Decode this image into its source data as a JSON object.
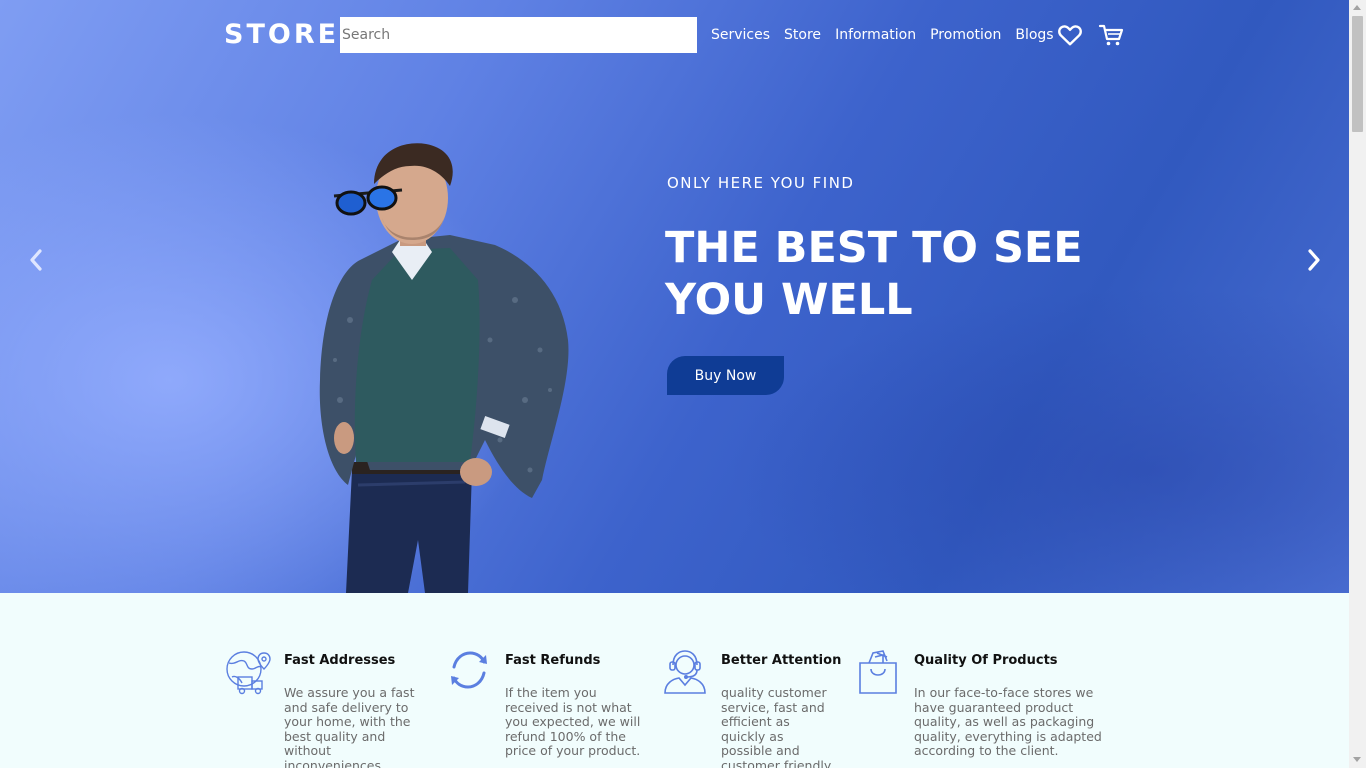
{
  "header": {
    "brand": "STORE",
    "search_placeholder": "Search",
    "nav": [
      "Services",
      "Store",
      "Information",
      "Promotion",
      "Blogs"
    ],
    "icons": [
      "heart-icon",
      "cart-icon"
    ]
  },
  "hero": {
    "tagline": "ONLY HERE YOU FIND",
    "headline_line1": "THE BEST TO SEE",
    "headline_line2": "YOU WELL",
    "button_label": "Buy Now",
    "colors": {
      "button": "#0f3c95",
      "background_dark": "#3159bf",
      "background_light": "#7f9df3"
    }
  },
  "features": [
    {
      "icon": "globe-delivery-icon",
      "title": "Fast Addresses",
      "text": "We assure you a fast and safe delivery to your home, with the best quality and without inconveniences."
    },
    {
      "icon": "refresh-icon",
      "title": "Fast Refunds",
      "text": "If the item you received is not what you expected, we will refund 100% of the price of your product."
    },
    {
      "icon": "support-agent-icon",
      "title": "Better Attention",
      "text": "quality customer service, fast and efficient as quickly as possible and customer friendly."
    },
    {
      "icon": "shopping-bag-icon",
      "title": "Quality Of Products",
      "text": "In our face-to-face stores we have guaranteed product quality, as well as packaging quality, everything is adapted according to the client."
    }
  ],
  "accent_icon_color": "#5b7fe0"
}
